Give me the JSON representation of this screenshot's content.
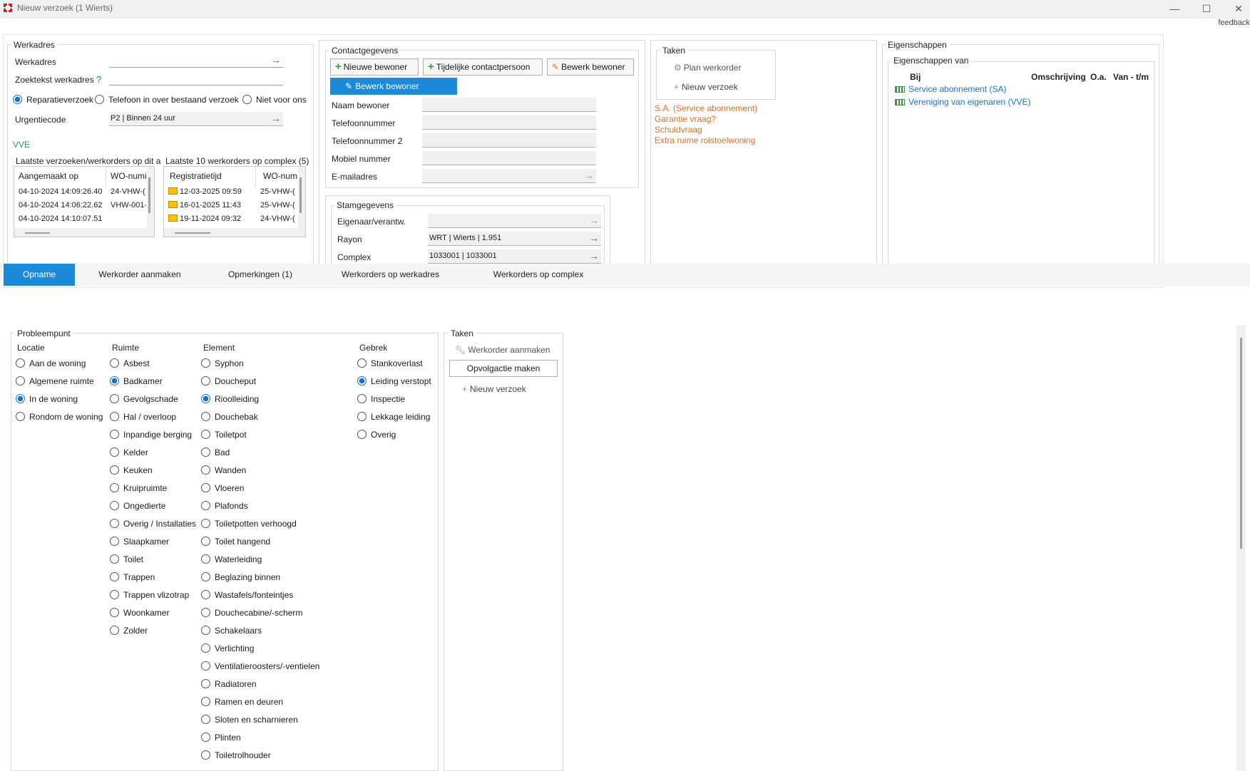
{
  "window": {
    "title": "Nieuw verzoek  (1 Wierts)",
    "minimize": "—",
    "maximize": "☐",
    "close": "✕",
    "feedback": "feedback"
  },
  "werkadres": {
    "group_title": "Werkadres",
    "werkadres_label": "Werkadres",
    "werkadres_value": "",
    "zoektekst_label": "Zoektekst werkadres",
    "help": "?",
    "zoektekst_value": "",
    "radios": [
      {
        "label": "Reparatieverzoek",
        "checked": true
      },
      {
        "label": "Telefoon in over bestaand verzoek",
        "checked": false
      },
      {
        "label": "Niet voor ons",
        "checked": false
      }
    ],
    "urgentie_label": "Urgentiecode",
    "urgentie_value": "P2 | Binnen 24 uur",
    "vve_label": "VVE",
    "list1_title": "Laatste verzoeken/werkorders op dit ac",
    "list1_headers": [
      "Aangemaakt op",
      "WO-numi"
    ],
    "list1_rows": [
      [
        "04-10-2024 14:09:26.40",
        "24-VHW-("
      ],
      [
        "04-10-2024 14:06:22.62",
        "VHW-001-"
      ],
      [
        "04-10-2024 14:10:07.51",
        ""
      ]
    ],
    "list2_title": "Laatste 10 werkorders op complex (5)",
    "list2_headers": [
      "Registratietijd",
      "WO-num"
    ],
    "list2_rows": [
      [
        "12-03-2025 09:59",
        "25-VHW-("
      ],
      [
        "16-01-2025 11:43",
        "25-VHW-("
      ],
      [
        "19-11-2024 09:32",
        "24-VHW-("
      ]
    ]
  },
  "contact": {
    "group_title": "Contactgegevens",
    "btn_nieuwe": "Nieuwe bewoner",
    "btn_tijdelijk": "Tijdelijke contactpersoon",
    "btn_bewerk": "Bewerk bewoner",
    "dropdown_bewerk": "Bewerk bewoner",
    "fields": [
      "Naam bewoner",
      "Telefoonnummer",
      "Telefoonnummer 2",
      "Mobiel nummer",
      "E-mailadres"
    ]
  },
  "stam": {
    "group_title": "Stamgegevens",
    "fields": [
      {
        "label": "Eigenaar/verantw.",
        "value": ""
      },
      {
        "label": "Rayon",
        "value": "WRT | Wierts | 1.951"
      },
      {
        "label": "Complex",
        "value": "1033001 | 1033001"
      }
    ]
  },
  "taken_top": {
    "group_title": "Taken",
    "plan": "Plan werkorder",
    "nieuw": "Nieuw verzoek",
    "alerts": [
      "S.A. (Service abonnement)",
      "Garantie vraag?",
      "Schuldvraag",
      "Extra ruime rolstoelwoning"
    ]
  },
  "eigenschappen": {
    "group_title": "Eigenschappen",
    "sub_title": "Eigenschappen van",
    "headers": [
      "Bij",
      "Omschrijving",
      "O.a.",
      "Van - t/m"
    ],
    "items": [
      "Service abonnement (SA)",
      "Vereniging van eigenaren (VVE)"
    ]
  },
  "tabs": [
    "Opname",
    "Werkorder aanmaken",
    "Opmerkingen (1)",
    "Werkorders op werkadres",
    "Werkorders op complex"
  ],
  "probleempunt": {
    "group_title": "Probleempunt",
    "locatie_title": "Locatie",
    "locatie": [
      {
        "label": "Aan de woning",
        "checked": false
      },
      {
        "label": "Algemene ruimte",
        "checked": false
      },
      {
        "label": "In de woning",
        "checked": true
      },
      {
        "label": "Rondom de woning",
        "checked": false
      }
    ],
    "ruimte_title": "Ruimte",
    "ruimte": [
      {
        "label": "Asbest",
        "checked": false
      },
      {
        "label": "Badkamer",
        "checked": true
      },
      {
        "label": "Gevolgschade",
        "checked": false
      },
      {
        "label": "Hal / overloop",
        "checked": false
      },
      {
        "label": "Inpandige berging",
        "checked": false
      },
      {
        "label": "Kelder",
        "checked": false
      },
      {
        "label": "Keuken",
        "checked": false
      },
      {
        "label": "Kruipruimte",
        "checked": false
      },
      {
        "label": "Ongedierte",
        "checked": false
      },
      {
        "label": "Overig / Installaties",
        "checked": false
      },
      {
        "label": "Slaapkamer",
        "checked": false
      },
      {
        "label": "Toilet",
        "checked": false
      },
      {
        "label": "Trappen",
        "checked": false
      },
      {
        "label": "Trappen vlizotrap",
        "checked": false
      },
      {
        "label": "Woonkamer",
        "checked": false
      },
      {
        "label": "Zolder",
        "checked": false
      }
    ],
    "element_title": "Element",
    "element": [
      {
        "label": "Syphon",
        "checked": false
      },
      {
        "label": "Doucheput",
        "checked": false
      },
      {
        "label": "Rioolleiding",
        "checked": true
      },
      {
        "label": "Douchebak",
        "checked": false
      },
      {
        "label": "Toiletpot",
        "checked": false
      },
      {
        "label": "Bad",
        "checked": false
      },
      {
        "label": "Wanden",
        "checked": false
      },
      {
        "label": "Vloeren",
        "checked": false
      },
      {
        "label": "Plafonds",
        "checked": false
      },
      {
        "label": "Toiletpotten verhoogd",
        "checked": false
      },
      {
        "label": "Toilet hangend",
        "checked": false
      },
      {
        "label": "Waterleiding",
        "checked": false
      },
      {
        "label": "Beglazing binnen",
        "checked": false
      },
      {
        "label": "Wastafels/fonteintjes",
        "checked": false
      },
      {
        "label": "Douchecabine/-scherm",
        "checked": false
      },
      {
        "label": "Schakelaars",
        "checked": false
      },
      {
        "label": "Verlichting",
        "checked": false
      },
      {
        "label": "Ventilatieroosters/-ventielen",
        "checked": false
      },
      {
        "label": "Radiatoren",
        "checked": false
      },
      {
        "label": "Ramen en deuren",
        "checked": false
      },
      {
        "label": "Sloten en scharnieren",
        "checked": false
      },
      {
        "label": "Plinten",
        "checked": false
      },
      {
        "label": "Toiletrolhouder",
        "checked": false
      }
    ],
    "gebrek_title": "Gebrek",
    "gebrek": [
      {
        "label": "Stankoverlast",
        "checked": false
      },
      {
        "label": "Leiding verstopt",
        "checked": true
      },
      {
        "label": "Inspectie",
        "checked": false
      },
      {
        "label": "Lekkage leiding",
        "checked": false
      },
      {
        "label": "Overig",
        "checked": false
      }
    ]
  },
  "taken_bottom": {
    "group_title": "Taken",
    "werkorder": "Werkorder aanmaken",
    "opvolg": "Opvolgactie maken",
    "nieuw": "Nieuw verzoek"
  }
}
